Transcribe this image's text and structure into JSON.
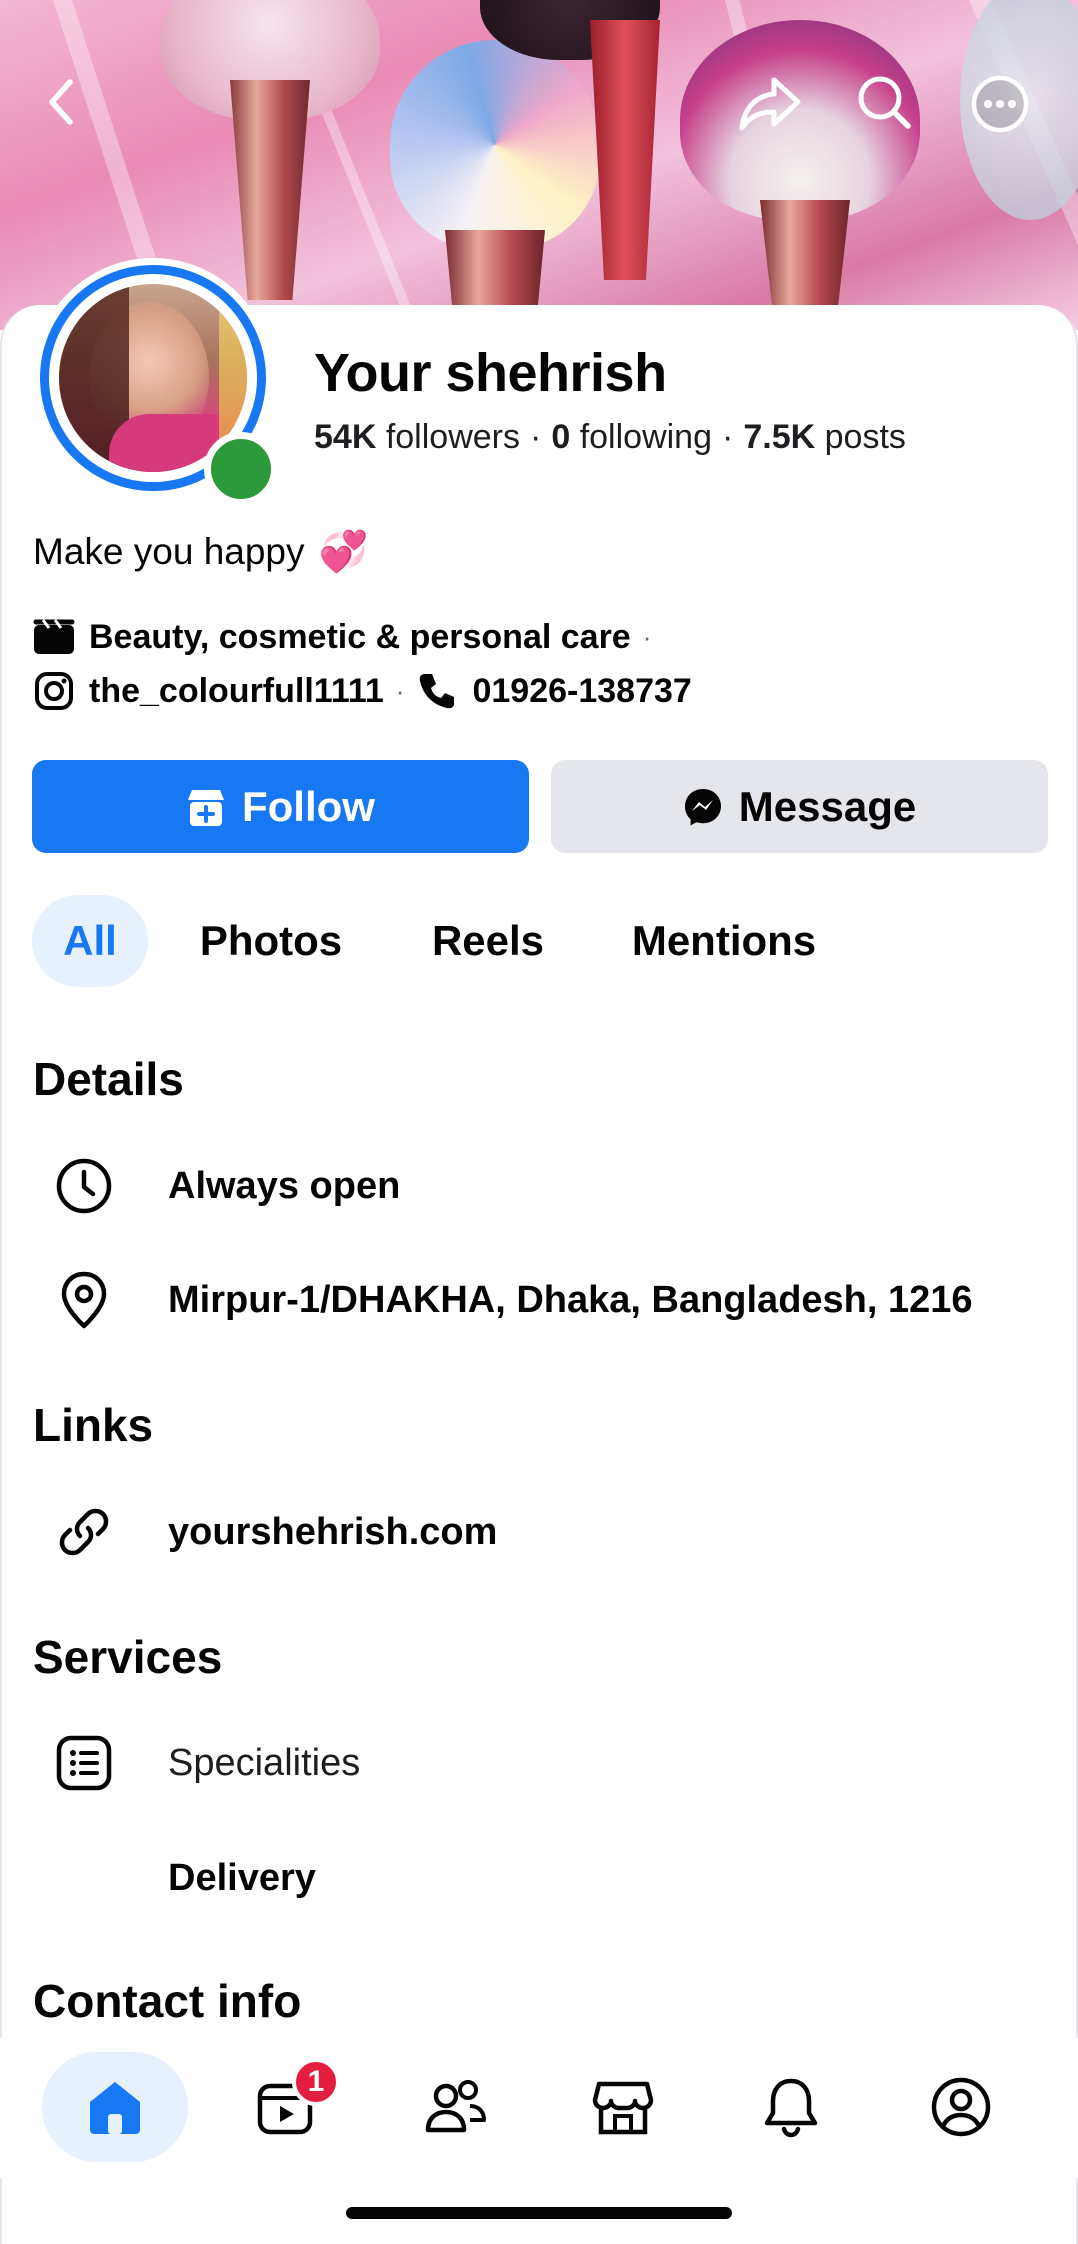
{
  "header": {
    "back_icon": "chevron-left-icon",
    "share_icon": "share-icon",
    "search_icon": "search-icon",
    "more_icon": "more-icon"
  },
  "profile": {
    "name": "Your shehrish",
    "followers_count": "54K",
    "followers_label": "followers",
    "following_count": "0",
    "following_label": "following",
    "posts_count": "7.5K",
    "posts_label": "posts",
    "separator": "·",
    "online": true,
    "bio": "Make you happy",
    "bio_emoji": "💞",
    "category": "Beauty, cosmetic & personal care",
    "instagram": "the_colourfull1111",
    "phone": "01926-138737"
  },
  "actions": {
    "follow_label": "Follow",
    "message_label": "Message"
  },
  "tabs": [
    {
      "label": "All",
      "active": true
    },
    {
      "label": "Photos",
      "active": false
    },
    {
      "label": "Reels",
      "active": false
    },
    {
      "label": "Mentions",
      "active": false
    }
  ],
  "details": {
    "title": "Details",
    "hours": "Always open",
    "address": "Mirpur-1/DHAKHA, Dhaka, Bangladesh, 1216"
  },
  "links": {
    "title": "Links",
    "website": "yourshehrish.com"
  },
  "services": {
    "title": "Services",
    "specialities": "Specialities",
    "delivery": "Delivery"
  },
  "contact": {
    "title": "Contact info"
  },
  "bottom_nav": {
    "items": [
      "home-icon",
      "video-icon",
      "friends-icon",
      "marketplace-icon",
      "bell-icon",
      "profile-icon"
    ],
    "video_badge": "1",
    "active": "home-icon"
  },
  "colors": {
    "brand_blue": "#1877f2",
    "online_green": "#2b9a3a",
    "badge_red": "#e41e3f"
  }
}
